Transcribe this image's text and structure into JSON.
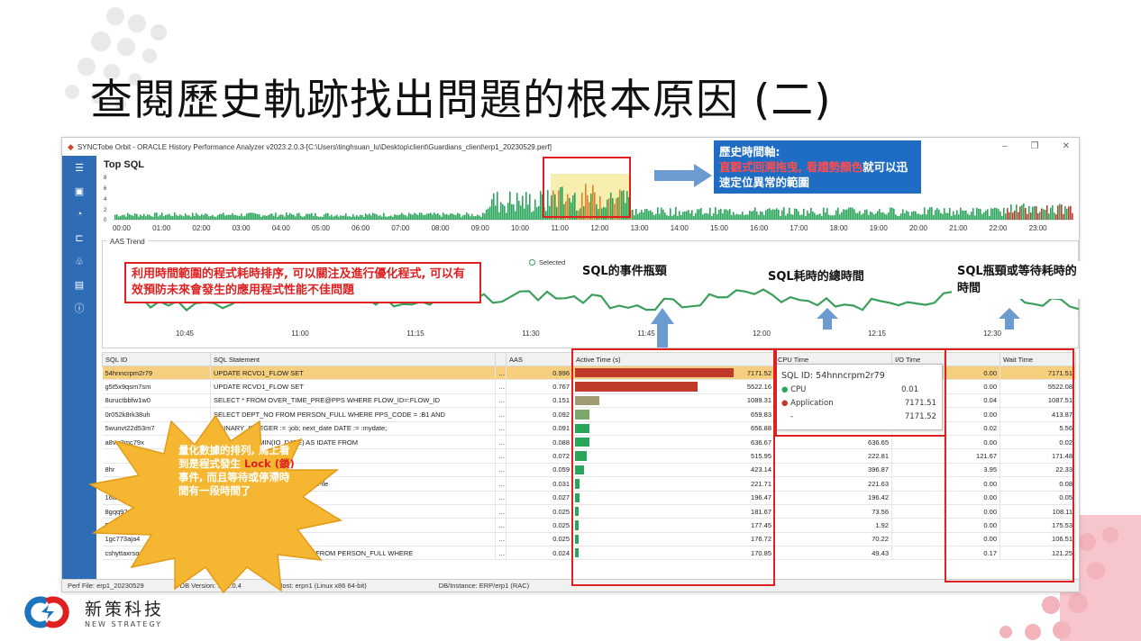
{
  "slide_title": "查閱歷史軌跡找出問題的根本原因 (二)",
  "app": {
    "window_title": "SYNCTobe Orbit - ORACLE History Performance Analyzer v2023.2.0.3-[C:\\Users\\tinghsuan_lu\\Desktop\\client\\Guardians_client\\erp1_20230529.perf]",
    "top_sql_label": "Top SQL",
    "aas_axis_label": "AAS",
    "aas_yticks": [
      "8",
      "6",
      "4",
      "2",
      "0"
    ],
    "timeline_ticks": [
      "00:00",
      "01:00",
      "02:00",
      "03:00",
      "04:00",
      "05:00",
      "06:00",
      "07:00",
      "08:00",
      "09:00",
      "10:00",
      "11:00",
      "12:00",
      "13:00",
      "14:00",
      "15:00",
      "16:00",
      "17:00",
      "18:00",
      "19:00",
      "20:00",
      "21:00",
      "22:00",
      "23:00"
    ],
    "aas_trend_label": "AAS Trend",
    "trend_legend": "Selected",
    "trend_yticks": [
      "1",
      "4",
      "2",
      "0"
    ],
    "trend_ticks": [
      "10:45",
      "11:00",
      "11:15",
      "11:30",
      "11:45",
      "12:00",
      "12:15",
      "12:30"
    ],
    "columns": [
      "SQL ID",
      "SQL Statement",
      "",
      "AAS",
      "Active Time (s)",
      "CPU Time",
      "I/O Time",
      "",
      "Wait Time"
    ],
    "rows": [
      {
        "id": "54hnncrpm2r79",
        "stmt": "UPDATE  RCVD1_FLOW SET",
        "dots": "…",
        "aas": "0.996",
        "active": "7171.52",
        "cpu": "",
        "io": "",
        "io2": "0.00",
        "wait": "7171.51"
      },
      {
        "id": "g5t5x9qsm7sm",
        "stmt": "UPDATE  RCVD1_FLOW SET",
        "dots": "…",
        "aas": "0.767",
        "active": "5522.16",
        "cpu": "",
        "io": "",
        "io2": "0.00",
        "wait": "5522.08"
      },
      {
        "id": "8uructbbfw1w0",
        "stmt": "SELECT * FROM OVER_TIME_PRE@PPS WHERE FLOW_ID=:FLOW_ID",
        "dots": "…",
        "aas": "0.151",
        "active": "1089.31",
        "cpu": "",
        "io": "",
        "io2": "0.04",
        "wait": "1087.51"
      },
      {
        "id": "0r052k8rk38uh",
        "stmt": "SELECT DEPT_NO FROM PERSON_FULL WHERE PPS_CODE = :B1 AND",
        "dots": "…",
        "aas": "0.092",
        "active": "659.83",
        "cpu": "",
        "io": "",
        "io2": "0.00",
        "wait": "413.87"
      },
      {
        "id": "5wunvt22d53m7",
        "stmt": "...BINARY_INTEGER := :job; next_date DATE := :mydate;",
        "dots": "…",
        "aas": "0.091",
        "active": "656.88",
        "cpu": "",
        "io": "",
        "io2": "0.02",
        "wait": "5.56"
      },
      {
        "id": "a8vrr3mc79x",
        "stmt": "...M ( SELECT MIN(IO_DATE) AS IDATE FROM",
        "dots": "…",
        "aas": "0.088",
        "active": "636.67",
        "cpu": "636.65",
        "io": "",
        "io2": "0.00",
        "wait": "0.02"
      },
      {
        "id": "",
        "stmt": "",
        "dots": "…",
        "aas": "0.072",
        "active": "515.95",
        "cpu": "222.81",
        "io": "",
        "io2": "121.67",
        "wait": "171.48"
      },
      {
        "id": "8hr",
        "stmt": "...S (",
        "dots": "…",
        "aas": "0.059",
        "active": "423.14",
        "cpu": "396.87",
        "io": "",
        "io2": "3.95",
        "wait": "22.33"
      },
      {
        "id": "f0t1",
        "stmt": "...text\",PATH as \"path\" FROM  F_MFile",
        "dots": "…",
        "aas": "0.031",
        "active": "221.71",
        "cpu": "221.63",
        "io": "",
        "io2": "0.00",
        "wait": "0.08"
      },
      {
        "id": "16adfd",
        "stmt": "...RD_PC,  DEPT,",
        "dots": "…",
        "aas": "0.027",
        "active": "196.47",
        "cpu": "196.42",
        "io": "",
        "io2": "0.00",
        "wait": "0.05"
      },
      {
        "id": "8gqq92zy",
        "stmt": "",
        "dots": "…",
        "aas": "0.025",
        "active": "181.67",
        "cpu": "73.56",
        "io": "",
        "io2": "0.00",
        "wait": "108.11"
      },
      {
        "id": "5rjspv",
        "stmt": "..._BY_ACT_TIME; end;",
        "dots": "…",
        "aas": "0.025",
        "active": "177.45",
        "cpu": "1.92",
        "io": "",
        "io2": "0.00",
        "wait": "175.53"
      },
      {
        "id": "1gc773aja4",
        "stmt": "",
        "dots": "…",
        "aas": "0.025",
        "active": "176.72",
        "cpu": "70.22",
        "io": "",
        "io2": "0.00",
        "wait": "106.51"
      },
      {
        "id": "cshyttaxrsqqa",
        "stmt": "SE...ME FROM ( SELECT NAME FROM PERSON_FULL WHERE",
        "dots": "…",
        "aas": "0.024",
        "active": "170.85",
        "cpu": "49.43",
        "io": "",
        "io2": "0.17",
        "wait": "121.25"
      }
    ],
    "tooltip": {
      "title": "SQL ID: 54hnncrpm2r79",
      "items": [
        {
          "label": "CPU",
          "value": "0.01",
          "color": "#2aa65a"
        },
        {
          "label": "Application",
          "value": "7171.51",
          "color": "#c0392b"
        },
        {
          "label": "-",
          "value": "7171.52",
          "color": ""
        }
      ]
    },
    "status": {
      "perf_file": "Perf File: erp1_20230529",
      "db_version": "DB Version: 11.2.0.4",
      "host": "Host: erpn1 (Linux x86 64-bit)",
      "instance": "DB/Instance: ERP/erp1 (RAC)"
    }
  },
  "callouts": {
    "history_title": "歷史時間軸:",
    "history_red": "直觀式回溯拖曳, 看趨勢顏色",
    "history_rest": "就可以迅速定位異常的範圍",
    "sort_text": "利用時間範圍的程式耗時排序, 可以關注及進行優化程式, 可以有效預防未來會發生的應用程式性能不佳問題",
    "sql_event": "SQL的事件瓶頸",
    "sql_total": "SQL耗時的總時間",
    "sql_wait": "SQL瓶頸或等待耗時的時間",
    "burst_pre": "量化數據的排列, 馬上看到是程式發生 ",
    "burst_red": "Lock (鎖)",
    "burst_post": " 事件, 而且等待或停滯時間有一段時間了"
  },
  "company": {
    "name_cn": "新策科技",
    "name_en": "NEW STRATEGY"
  },
  "colors": {
    "accent": "#2e6cb6",
    "highlight_red": "#e02020",
    "selected_row": "#f6cf7e",
    "trend_green": "#3a9f5a"
  }
}
